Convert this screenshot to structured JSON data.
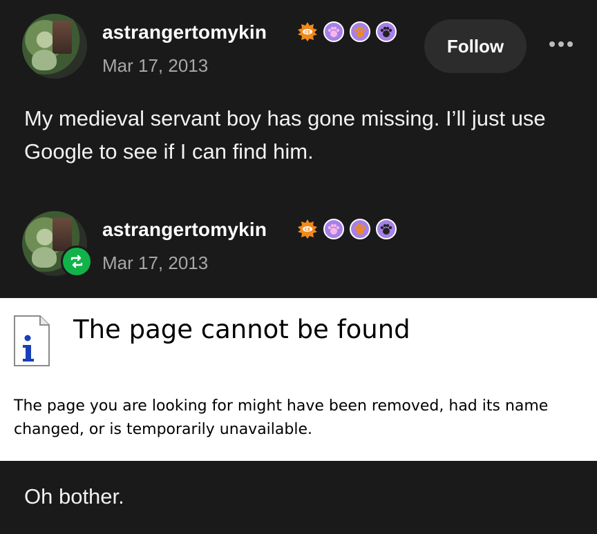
{
  "post": {
    "username": "astrangertomykin",
    "date": "Mar 17, 2013",
    "follow_label": "Follow",
    "text": "My medieval servant boy has gone missing. I’ll just use Google to see if I can find him."
  },
  "reblog": {
    "username": "astrangertomykin",
    "date": "Mar 17, 2013"
  },
  "error_page": {
    "title": "The page cannot be found",
    "body": "The page you are looking for might have been removed, had its name changed, or is temporarily unavailable."
  },
  "closing_text": "Oh bother.",
  "icons": {
    "badge_sun": "orange-sun-badge-icon",
    "badge_paw_pink": "pink-paw-badge-icon",
    "badge_paw_orange": "orange-paw-badge-icon",
    "badge_paw_gray": "gray-paw-badge-icon",
    "reblog": "reblog-icon",
    "info": "info-page-icon",
    "more": "more-options-icon"
  },
  "colors": {
    "background": "#1a1a1a",
    "follow_button": "#2c2c2c",
    "reblog_green": "#12b24a",
    "badge_orange": "#f08a1c",
    "badge_purple": "#a680e8",
    "badge_pink": "#e89ad6"
  }
}
